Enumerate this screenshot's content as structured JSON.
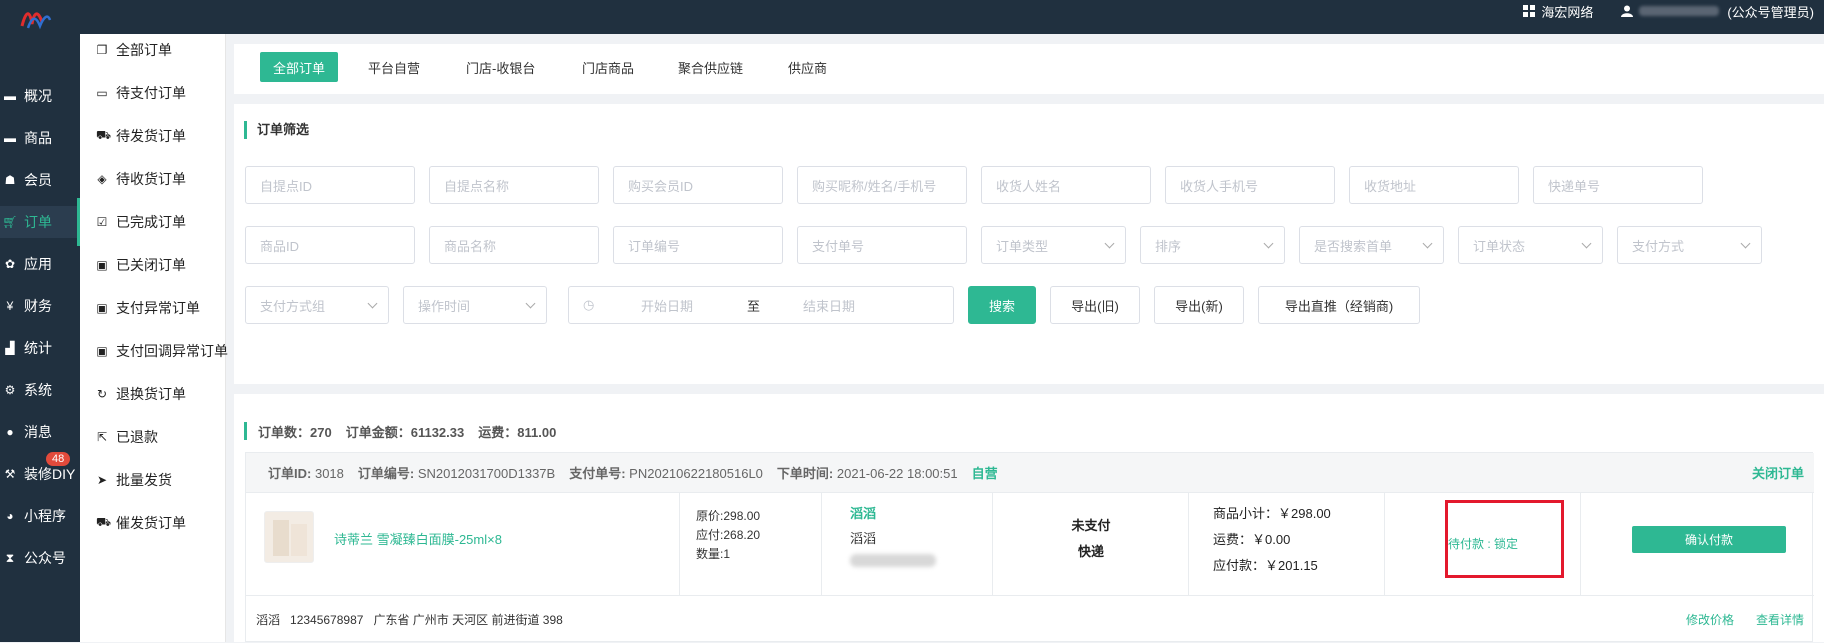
{
  "top_bar": {
    "site_name": "海宏网络",
    "user_role": "(公众号管理员)"
  },
  "left_nav": {
    "items": [
      {
        "label": "概况",
        "icon": "dashboard-icon"
      },
      {
        "label": "商品",
        "icon": "goods-icon"
      },
      {
        "label": "会员",
        "icon": "members-icon"
      },
      {
        "label": "订单",
        "icon": "cart-icon"
      },
      {
        "label": "应用",
        "icon": "apps-icon"
      },
      {
        "label": "财务",
        "icon": "yen-icon"
      },
      {
        "label": "统计",
        "icon": "bar-chart-icon"
      },
      {
        "label": "系统",
        "icon": "gears-icon"
      },
      {
        "label": "消息",
        "icon": "chat-icon"
      },
      {
        "label": "装修DIY",
        "icon": "hammer-icon"
      },
      {
        "label": "小程序",
        "icon": "wechat-icon"
      },
      {
        "label": "公众号",
        "icon": "hourglass-icon"
      }
    ],
    "message_badge": "48",
    "active_index": 3
  },
  "sub_nav": {
    "items": [
      {
        "label": "全部订单",
        "icon": "copy-icon"
      },
      {
        "label": "待支付订单",
        "icon": "credit-card-icon"
      },
      {
        "label": "待发货订单",
        "icon": "truck-icon"
      },
      {
        "label": "待收货订单",
        "icon": "dropbox-icon"
      },
      {
        "label": "已完成订单",
        "icon": "check-square-icon"
      },
      {
        "label": "已关闭订单",
        "icon": "trash-icon"
      },
      {
        "label": "支付异常订单",
        "icon": "trash-icon"
      },
      {
        "label": "支付回调异常订单",
        "icon": "trash-icon"
      },
      {
        "label": "退换货订单",
        "icon": "refresh-icon"
      },
      {
        "label": "已退款",
        "icon": "share-icon"
      },
      {
        "label": "批量发货",
        "icon": "paper-plane-icon"
      },
      {
        "label": "催发货订单",
        "icon": "truck-icon"
      }
    ]
  },
  "tabs": [
    "全部订单",
    "平台自营",
    "门店-收银台",
    "门店商品",
    "聚合供应链",
    "供应商"
  ],
  "filter": {
    "title": "订单筛选",
    "row1_placeholders": [
      "自提点ID",
      "自提点名称",
      "购买会员ID",
      "购买昵称/姓名/手机号",
      "收货人姓名",
      "收货人手机号",
      "收货地址",
      "快递单号"
    ],
    "row2_placeholders": [
      "商品ID",
      "商品名称",
      "订单编号",
      "支付单号"
    ],
    "row2_selects": [
      "订单类型",
      "排序",
      "是否搜索首单",
      "订单状态",
      "支付方式"
    ],
    "row3_selects": [
      "支付方式组",
      "操作时间"
    ],
    "date_start": "开始日期",
    "date_sep": "至",
    "date_end": "结束日期",
    "buttons": {
      "search": "搜索",
      "export_old": "导出(旧)",
      "export_new": "导出(新)",
      "export_direct": "导出直推（经销商)"
    }
  },
  "summary": {
    "count_label": "订单数：",
    "count": "270",
    "amount_label": "订单金额：",
    "amount": "61132.33",
    "freight_label": "运费：",
    "freight": "811.00"
  },
  "order": {
    "id_label": "订单ID:",
    "id": "3018",
    "sn_label": "订单编号:",
    "sn": "SN2012031700D1337B",
    "pay_label": "支付单号:",
    "pay_sn": "PN20210622180516L0",
    "time_label": "下单时间:",
    "time": "2021-06-22 18:00:51",
    "tag": "自营",
    "close_action": "关闭订单",
    "product_name": "诗蒂兰 雪凝臻白面膜-25ml×8",
    "price_original_label": "原价:",
    "price_original": "298.00",
    "price_payable_label": "应付:",
    "price_payable": "268.20",
    "quantity_label": "数量:",
    "quantity": "1",
    "buyer_link": "滔滔",
    "buyer_name": "滔滔",
    "pay_status": "未支付",
    "delivery": "快递",
    "subtotal_label": "商品小计：",
    "subtotal": "￥298.00",
    "shipping_label": "运费：",
    "shipping": "￥0.00",
    "payable_label": "应付款：",
    "payable": "￥201.15",
    "status_text": "待付款 : 锁定",
    "confirm_button": "确认付款",
    "address_name": "滔滔",
    "address_phone": "12345678987",
    "address_detail": "广东省 广州市 天河区 前进街道 398",
    "modify_price": "修改价格",
    "view_detail": "查看详情"
  }
}
